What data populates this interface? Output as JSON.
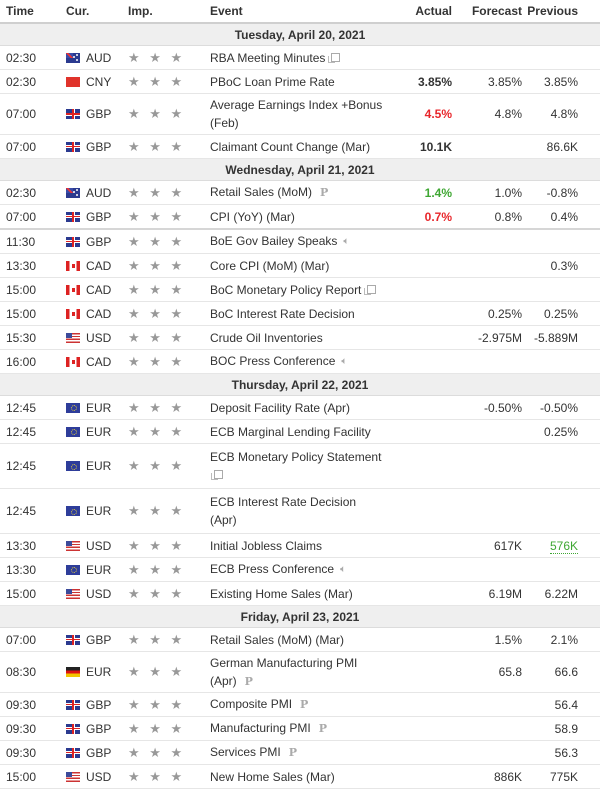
{
  "header": {
    "time": "Time",
    "cur": "Cur.",
    "imp": "Imp.",
    "event": "Event",
    "actual": "Actual",
    "forecast": "Forecast",
    "previous": "Previous"
  },
  "importance_glyph": "★ ★ ★",
  "colors": {
    "positive": "#3fa733",
    "negative": "#e8262b",
    "star": "#999999"
  },
  "days": [
    {
      "label": "Tuesday, April 20, 2021",
      "events": [
        {
          "time": "02:30",
          "cur": "AUD",
          "flag": "aud",
          "event": "RBA Meeting Minutes",
          "icon": "doc-icon",
          "actual": "",
          "forecast": "",
          "previous": ""
        },
        {
          "time": "02:30",
          "cur": "CNY",
          "flag": "cny",
          "event": "PBoC Loan Prime Rate",
          "actual": "3.85%",
          "forecast": "3.85%",
          "previous": "3.85%"
        },
        {
          "time": "07:00",
          "cur": "GBP",
          "flag": "gbp",
          "event": "Average Earnings Index +Bonus (Feb)",
          "actual": "4.5%",
          "actual_color": "red",
          "forecast": "4.8%",
          "previous": "4.8%",
          "tall": true
        },
        {
          "time": "07:00",
          "cur": "GBP",
          "flag": "gbp",
          "event": "Claimant Count Change (Mar)",
          "actual": "10.1K",
          "forecast": "",
          "previous": "86.6K"
        }
      ]
    },
    {
      "label": "Wednesday, April 21, 2021",
      "events": [
        {
          "time": "02:30",
          "cur": "AUD",
          "flag": "aud",
          "event": "Retail Sales (MoM)",
          "icon": "p-icon",
          "actual": "1.4%",
          "actual_color": "green",
          "forecast": "1.0%",
          "previous": "-0.8%"
        },
        {
          "time": "07:00",
          "cur": "GBP",
          "flag": "gbp",
          "event": "CPI (YoY) (Mar)",
          "actual": "0.7%",
          "actual_color": "red",
          "forecast": "0.8%",
          "previous": "0.4%",
          "group_end": true
        },
        {
          "time": "11:30",
          "cur": "GBP",
          "flag": "gbp",
          "event": "BoE Gov Bailey Speaks",
          "icon": "speaker-icon",
          "actual": "",
          "forecast": "",
          "previous": ""
        },
        {
          "time": "13:30",
          "cur": "CAD",
          "flag": "cad",
          "event": "Core CPI (MoM) (Mar)",
          "actual": "",
          "forecast": "",
          "previous": "0.3%"
        },
        {
          "time": "15:00",
          "cur": "CAD",
          "flag": "cad",
          "event": "BoC Monetary Policy Report",
          "icon": "doc-icon",
          "actual": "",
          "forecast": "",
          "previous": ""
        },
        {
          "time": "15:00",
          "cur": "CAD",
          "flag": "cad",
          "event": "BoC Interest Rate Decision",
          "actual": "",
          "forecast": "0.25%",
          "previous": "0.25%"
        },
        {
          "time": "15:30",
          "cur": "USD",
          "flag": "usd",
          "event": "Crude Oil Inventories",
          "actual": "",
          "forecast": "-2.975M",
          "previous": "-5.889M"
        },
        {
          "time": "16:00",
          "cur": "CAD",
          "flag": "cad",
          "event": "BOC Press Conference",
          "icon": "speaker-icon",
          "actual": "",
          "forecast": "",
          "previous": ""
        }
      ]
    },
    {
      "label": "Thursday, April 22, 2021",
      "events": [
        {
          "time": "12:45",
          "cur": "EUR",
          "flag": "eur",
          "event": "Deposit Facility Rate (Apr)",
          "actual": "",
          "forecast": "-0.50%",
          "previous": "-0.50%"
        },
        {
          "time": "12:45",
          "cur": "EUR",
          "flag": "eur",
          "event": "ECB Marginal Lending Facility",
          "actual": "",
          "forecast": "",
          "previous": "0.25%"
        },
        {
          "time": "12:45",
          "cur": "EUR",
          "flag": "eur",
          "event": "ECB Monetary Policy Statement",
          "icon": "doc-icon",
          "icon_newline": true,
          "actual": "",
          "forecast": "",
          "previous": "",
          "tall2": true
        },
        {
          "time": "12:45",
          "cur": "EUR",
          "flag": "eur",
          "event": "ECB Interest Rate Decision (Apr)",
          "actual": "",
          "forecast": "",
          "previous": "",
          "tall2": true
        },
        {
          "time": "13:30",
          "cur": "USD",
          "flag": "usd",
          "event": "Initial Jobless Claims",
          "actual": "",
          "forecast": "617K",
          "previous": "576K",
          "previous_color": "green-u"
        },
        {
          "time": "13:30",
          "cur": "EUR",
          "flag": "eur",
          "event": "ECB Press Conference",
          "icon": "speaker-icon",
          "actual": "",
          "forecast": "",
          "previous": ""
        },
        {
          "time": "15:00",
          "cur": "USD",
          "flag": "usd",
          "event": "Existing Home Sales (Mar)",
          "actual": "",
          "forecast": "6.19M",
          "previous": "6.22M"
        }
      ]
    },
    {
      "label": "Friday, April 23, 2021",
      "events": [
        {
          "time": "07:00",
          "cur": "GBP",
          "flag": "gbp",
          "event": "Retail Sales (MoM) (Mar)",
          "actual": "",
          "forecast": "1.5%",
          "previous": "2.1%"
        },
        {
          "time": "08:30",
          "cur": "EUR",
          "flag": "deu",
          "event": "German Manufacturing PMI (Apr)",
          "icon": "p-icon",
          "actual": "",
          "forecast": "65.8",
          "previous": "66.6",
          "tall": true
        },
        {
          "time": "09:30",
          "cur": "GBP",
          "flag": "gbp",
          "event": "Composite PMI",
          "icon": "p-icon",
          "actual": "",
          "forecast": "",
          "previous": "56.4"
        },
        {
          "time": "09:30",
          "cur": "GBP",
          "flag": "gbp",
          "event": "Manufacturing PMI",
          "icon": "p-icon",
          "actual": "",
          "forecast": "",
          "previous": "58.9"
        },
        {
          "time": "09:30",
          "cur": "GBP",
          "flag": "gbp",
          "event": "Services PMI",
          "icon": "p-icon",
          "actual": "",
          "forecast": "",
          "previous": "56.3"
        },
        {
          "time": "15:00",
          "cur": "USD",
          "flag": "usd",
          "event": "New Home Sales (Mar)",
          "actual": "",
          "forecast": "886K",
          "previous": "775K"
        }
      ]
    }
  ]
}
